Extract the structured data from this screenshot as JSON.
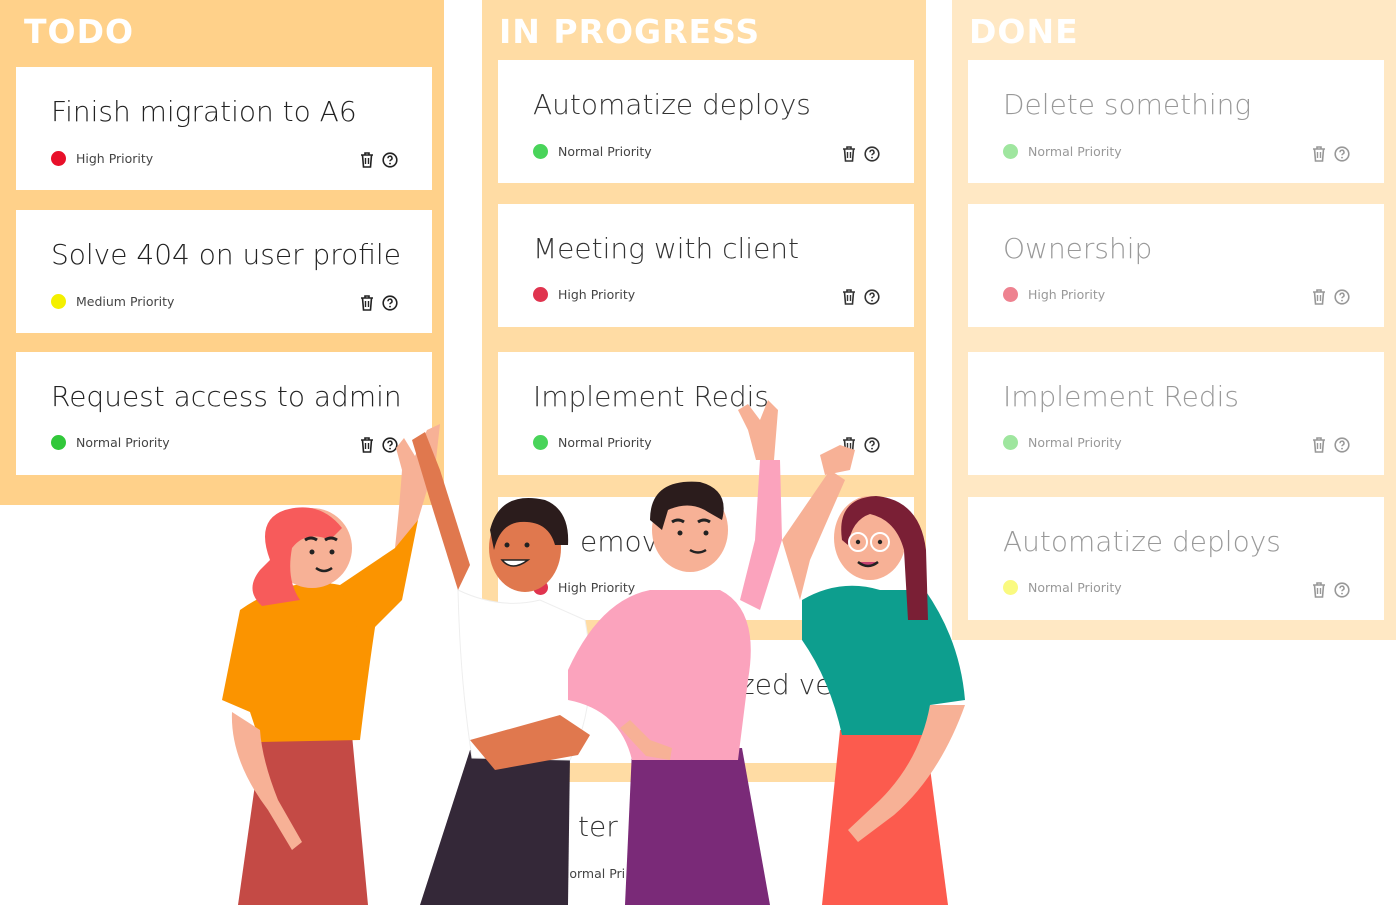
{
  "board": {
    "columns": [
      {
        "title": "TODO",
        "cards": [
          {
            "title": "Finish migration to A6",
            "priority": "High Priority",
            "priority_color": "#e8102a"
          },
          {
            "title": "Solve 404 on user profile",
            "priority": "Medium Priority",
            "priority_color": "#f4f000"
          },
          {
            "title": "Request access to admin",
            "priority": "Normal Priority",
            "priority_color": "#31c83a"
          }
        ]
      },
      {
        "title": "IN PROGRESS",
        "cards": [
          {
            "title": "Automatize deploys",
            "priority": "Normal Priority",
            "priority_color": "#49d45a"
          },
          {
            "title": "Meeting with client",
            "priority": "High Priority",
            "priority_color": "#e0344f"
          },
          {
            "title": "Implement Redis",
            "priority": "Normal Priority",
            "priority_color": "#49d45a"
          },
          {
            "title": "emove",
            "priority": "High Priority",
            "priority_color": "#e0344f"
          },
          {
            "title": "zed ver",
            "priority": "",
            "priority_color": "#49d45a"
          },
          {
            "title": "ter o",
            "priority": "Normal Pri",
            "priority_color": "#49d45a"
          }
        ]
      },
      {
        "title": "DONE",
        "cards": [
          {
            "title": "Delete something",
            "priority": "Normal Priority",
            "priority_color": "#3dd04c"
          },
          {
            "title": "Ownership",
            "priority": "High Priority",
            "priority_color": "#e0344f"
          },
          {
            "title": "Implement Redis",
            "priority": "Normal Priority",
            "priority_color": "#3dd04c"
          },
          {
            "title": "Automatize deploys",
            "priority": "Normal Priority",
            "priority_color": "#f4f000"
          }
        ]
      }
    ]
  },
  "colors": {
    "todo_bg": "#ffd18a",
    "in_progress_bg": "#ffdca4",
    "done_bg": "#ffe8c4"
  }
}
